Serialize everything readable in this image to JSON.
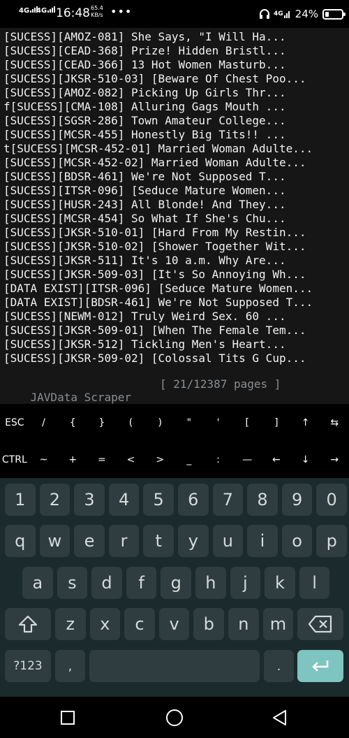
{
  "status_bar": {
    "network_1": "4G",
    "network_2": "4G",
    "time": "16:48",
    "speed_value": "65.4",
    "speed_unit": "KB/s",
    "overflow": "•••",
    "network_3": "4G",
    "battery_pct": "24%",
    "battery_level": 0.24
  },
  "terminal": {
    "lines": [
      "[SUCESS][AMOZ-081] She Says, \"I Will Ha...",
      "[SUCESS][CEAD-368] Prize! Hidden Bristl...",
      "[SUCESS][CEAD-366] 13 Hot Women Masturb...",
      "[SUCESS][JKSR-510-03] [Beware Of Chest Poo...",
      "[SUCESS][AMOZ-082] Picking Up Girls Thr...",
      "f[SUCESS][CMA-108] Alluring Gags Mouth ...",
      "[SUCESS][SGSR-286] Town Amateur College...",
      "[SUCESS][MCSR-455] Honestly Big Tits!! ...",
      "t[SUCESS][MCSR-452-01] Married Woman Adulte...",
      "[SUCESS][MCSR-452-02] Married Woman Adulte...",
      "[SUCESS][BDSR-461] We're Not Supposed T...",
      "[SUCESS][ITSR-096] [Seduce Mature Women...",
      "[SUCESS][HUSR-243] All Blonde! And They...",
      "[SUCESS][MCSR-454] So What If She's Chu...",
      "[SUCESS][JKSR-510-01] [Hard From My Restin...",
      "[SUCESS][JKSR-510-02] [Shower Together Wit...",
      "[SUCESS][JKSR-511] It's 10 a.m. Why Are...",
      "[SUCESS][JKSR-509-03] [It's So Annoying Wh...",
      "[DATA EXIST][ITSR-096] [Seduce Mature Women...",
      "[DATA EXIST][BDSR-461] We're Not Supposed T...",
      "[SUCESS][NEWM-012] Truly Weird Sex. 60 ...",
      "[SUCESS][JKSR-509-01] [When The Female Tem...",
      "[SUCESS][JKSR-512] Tickling Men's Heart...",
      "[SUCESS][JKSR-509-02] [Colossal Tits G Cup..."
    ],
    "app_name": "JAVData Scraper",
    "progress": "[ 21/12387 pages ]"
  },
  "extra_keys": {
    "row1": [
      "ESC",
      "/",
      "{",
      "}",
      "(",
      ")",
      "\"",
      "'",
      "[",
      "]",
      "↑",
      "⇆"
    ],
    "row2": [
      "CTRL",
      "~",
      "+",
      "=",
      "<",
      ">",
      "_",
      ":",
      "—",
      "←",
      "↓",
      "→"
    ]
  },
  "keyboard": {
    "numbers": [
      "1",
      "2",
      "3",
      "4",
      "5",
      "6",
      "7",
      "8",
      "9",
      "0"
    ],
    "row1": [
      "q",
      "w",
      "e",
      "r",
      "t",
      "y",
      "u",
      "i",
      "o",
      "p"
    ],
    "row2": [
      "a",
      "s",
      "d",
      "f",
      "g",
      "h",
      "j",
      "k",
      "l"
    ],
    "row3": [
      "z",
      "x",
      "c",
      "v",
      "b",
      "n",
      "m"
    ],
    "symbols_label": "?123",
    "comma": ",",
    "period": "."
  },
  "colors": {
    "terminal_bg": "#161616",
    "keyboard_bg": "#1b2a2c",
    "key_bg": "#2f3d40",
    "enter_bg": "#7ec4c0"
  },
  "icons": {
    "headphones": "headphones-icon",
    "battery": "battery-icon",
    "shift": "shift-icon",
    "backspace": "backspace-icon",
    "enter": "enter-icon",
    "recents": "square-icon",
    "home": "circle-icon",
    "back": "triangle-icon"
  }
}
